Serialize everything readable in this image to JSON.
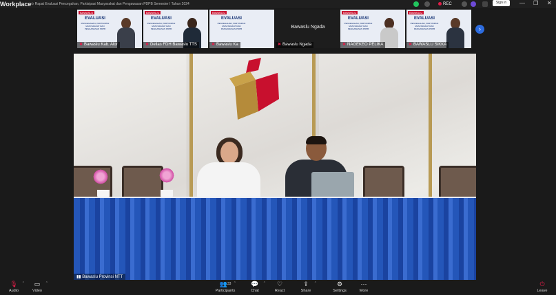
{
  "app": {
    "name": "Workplace",
    "meeting_title": "Rapat Evaluasi Pencegahan, Partisipasi Masyarakat dan Pengawasan PDPB Semester I Tahun 2024"
  },
  "titlebar": {
    "rec_label": "REC",
    "signin_label": "Sign in",
    "minimize": "—",
    "restore": "❐",
    "close": "✕"
  },
  "colors": {
    "accent": "#2d6cdf",
    "rec": "#e11d48",
    "shield": "#22c55e",
    "tablecloth": "#2456b9"
  },
  "banner": {
    "brand": "BAWASLU",
    "title": "EVALUASI",
    "subtitle": "PENCEGAHAN, PARTISIPASI MASYARAKAT DAN PENGAWASAN PDPB"
  },
  "strip": {
    "participants": [
      {
        "name": "Bawaslu Kab. Alor"
      },
      {
        "name": "Dellas FDH Bawaslu TTS"
      },
      {
        "name": "Bawaslu Ka"
      },
      {
        "name": "Bawaslu Ngada",
        "no_video": true
      },
      {
        "name": "NAGEKEO PELIKA"
      },
      {
        "name": "BAWASLU SIKKA"
      }
    ],
    "next_icon": "chevron-right-icon"
  },
  "main_video": {
    "speaker_name": "Bawaslu Provinsi NTT"
  },
  "toolbar": {
    "audio": {
      "label": "Audio",
      "icon": "microphone-muted-icon"
    },
    "video": {
      "label": "Video",
      "icon": "video-camera-icon"
    },
    "participants": {
      "label": "Participants",
      "count": "33"
    },
    "chat": {
      "label": "Chat"
    },
    "react": {
      "label": "React"
    },
    "share": {
      "label": "Share"
    },
    "settings": {
      "label": "Settings"
    },
    "more": {
      "label": "More"
    },
    "leave": {
      "label": "Leave"
    }
  }
}
